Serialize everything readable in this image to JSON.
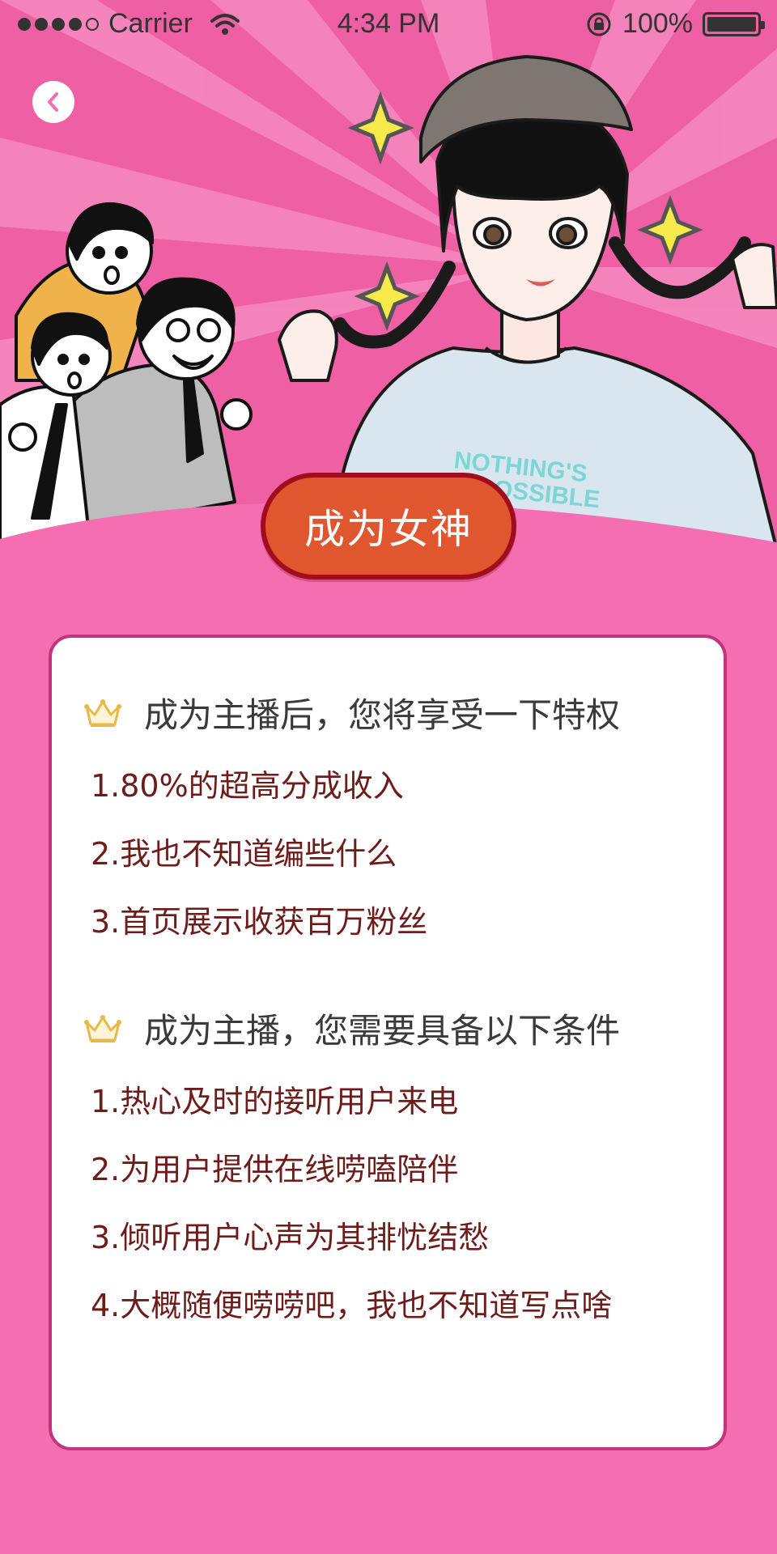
{
  "status_bar": {
    "carrier": "Carrier",
    "time": "4:34 PM",
    "battery_percent": "100%",
    "signal_bars_filled": 4,
    "signal_bars_total": 5
  },
  "hero": {
    "tshirt_text_line1": "NOTHING'S",
    "tshirt_text_line2": "IMPOSSIBLE"
  },
  "cta": {
    "label": "成为女神"
  },
  "privileges": {
    "title": "成为主播后，您将享受一下特权",
    "items": [
      "1.80%的超高分成收入",
      "2.我也不知道编些什么",
      "3.首页展示收获百万粉丝"
    ]
  },
  "requirements": {
    "title": "成为主播，您需要具备以下条件",
    "items": [
      "1.热心及时的接听用户来电",
      "2.为用户提供在线唠嗑陪伴",
      "3.倾听用户心声为其排忧结愁",
      "4.大概随便唠唠吧，我也不知道写点啥"
    ]
  },
  "colors": {
    "background": "#f56eb1",
    "hero_pink": "#ee5fa4",
    "cta_fill": "#e0562f",
    "cta_border": "#a10d1e",
    "card_border": "#c2347d",
    "item_text": "#6e1c1a"
  },
  "icons": {
    "back": "chevron-left-icon",
    "section": "crown-icon"
  }
}
